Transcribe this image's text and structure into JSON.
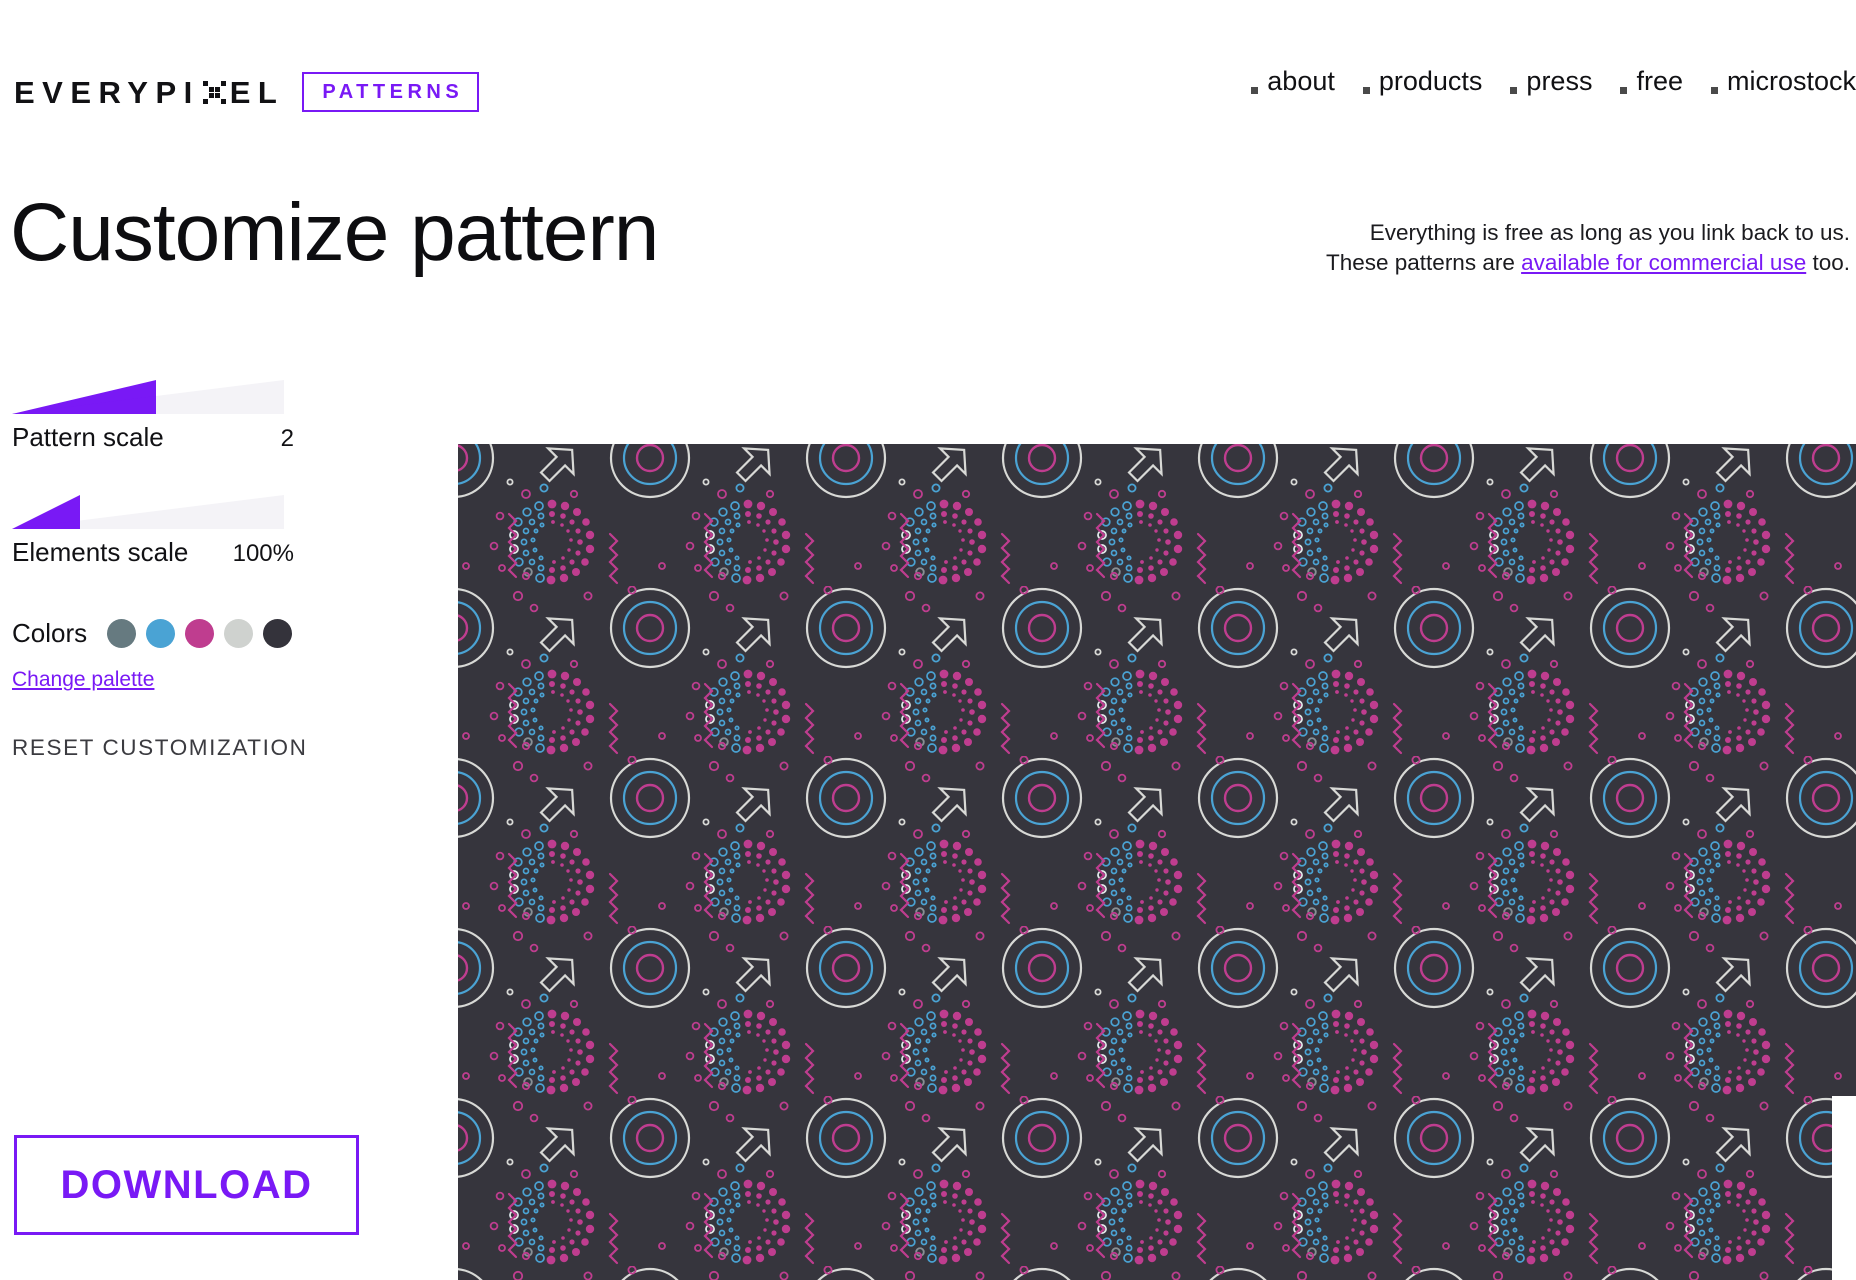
{
  "header": {
    "brand_part1": "EVERYPI",
    "brand_x_icon": "pixel-x-icon",
    "brand_part2": "EL",
    "badge": "PATTERNS",
    "nav": [
      {
        "label": "about",
        "bullet_icon": "square-bullet-icon"
      },
      {
        "label": "products",
        "bullet_icon": "square-bullet-icon"
      },
      {
        "label": "press",
        "bullet_icon": "square-bullet-icon"
      },
      {
        "label": "free",
        "bullet_icon": "square-bullet-icon"
      },
      {
        "label": "microstock",
        "bullet_icon": "square-bullet-icon"
      }
    ]
  },
  "page": {
    "title": "Customize pattern",
    "notice_line1": "Everything is free as long as you link back to us.",
    "notice_line2_pre": "These patterns are ",
    "notice_link": "available for commercial use",
    "notice_line2_post": " too."
  },
  "controls": {
    "pattern_scale": {
      "label": "Pattern scale",
      "value": "2",
      "fill_percent": 53
    },
    "elements_scale": {
      "label": "Elements scale",
      "value": "100%",
      "fill_percent": 25
    },
    "colors_label": "Colors",
    "swatches": [
      {
        "name": "swatch-slate",
        "hex": "#667a80"
      },
      {
        "name": "swatch-blue",
        "hex": "#4aa3d4"
      },
      {
        "name": "swatch-magenta",
        "hex": "#bf3d8f"
      },
      {
        "name": "swatch-light-gray",
        "hex": "#cfd2cf"
      },
      {
        "name": "swatch-charcoal",
        "hex": "#34333b"
      }
    ],
    "change_palette": "Change palette",
    "reset": "RESET CUSTOMIZATION",
    "download": "DOWNLOAD"
  },
  "preview": {
    "background_hex": "#36353d",
    "ring_outer_hex": "#d8d9d6",
    "ring_mid_hex": "#4aa3d4",
    "ring_inner_hex": "#bf3d8f",
    "dot_magenta_hex": "#bf3d8f",
    "dot_blue_hex": "#4aa3d4",
    "arrow_hex": "#d8d9d6",
    "squiggle_hex": "#bf3d8f",
    "motifs": [
      "concentric-rings",
      "dotted-halo",
      "outline-arrow",
      "zigzag-squiggle",
      "scattered-small-circles"
    ],
    "accent_hex": "#7919f5"
  }
}
